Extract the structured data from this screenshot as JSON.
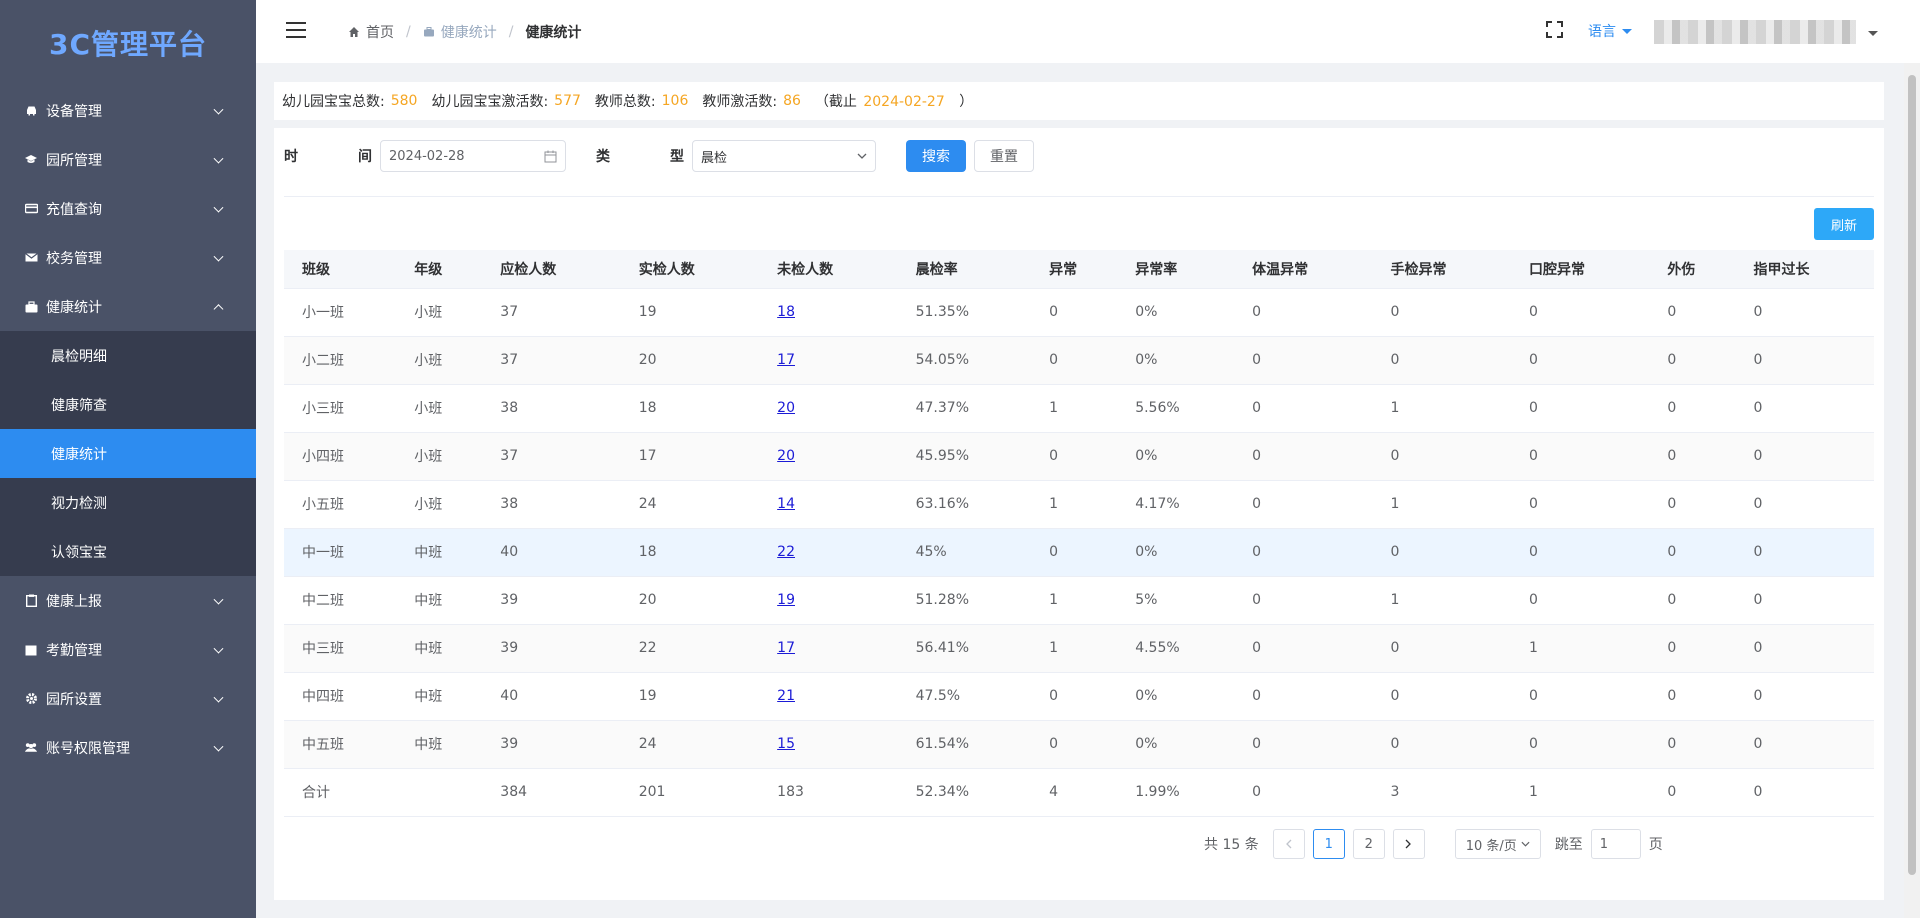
{
  "app": {
    "title": "3C管理平台"
  },
  "sidebar": {
    "items": [
      {
        "label": "设备管理",
        "icon": "car-icon",
        "expanded": false
      },
      {
        "label": "园所管理",
        "icon": "graduation-cap-icon",
        "expanded": false
      },
      {
        "label": "充值查询",
        "icon": "card-icon",
        "expanded": false
      },
      {
        "label": "校务管理",
        "icon": "envelope-icon",
        "expanded": false
      },
      {
        "label": "健康统计",
        "icon": "briefcase-icon",
        "expanded": true,
        "children": [
          {
            "label": "晨检明细"
          },
          {
            "label": "健康筛查"
          },
          {
            "label": "健康统计",
            "active": true
          },
          {
            "label": "视力检测"
          },
          {
            "label": "认领宝宝"
          }
        ]
      },
      {
        "label": "健康上报",
        "icon": "clipboard-icon",
        "expanded": false
      },
      {
        "label": "考勤管理",
        "icon": "calendar-icon",
        "expanded": false
      },
      {
        "label": "园所设置",
        "icon": "gear-icon",
        "expanded": false
      },
      {
        "label": "账号权限管理",
        "icon": "users-icon",
        "expanded": false
      }
    ]
  },
  "header": {
    "breadcrumb": [
      "首页",
      "健康统计",
      "健康统计"
    ],
    "language": "语言"
  },
  "summary": {
    "kid_total_label": "幼儿园宝宝总数:",
    "kid_total": "580",
    "kid_active_label": "幼儿园宝宝激活数:",
    "kid_active": "577",
    "teacher_total_label": "教师总数:",
    "teacher_total": "106",
    "teacher_active_label": "教师激活数:",
    "teacher_active": "86",
    "deadline_prefix": "（截止",
    "deadline_date": "2024-02-27",
    "deadline_suffix": "）"
  },
  "filters": {
    "time_label_a": "时",
    "time_label_b": "间",
    "date_value": "2024-02-28",
    "type_label_a": "类",
    "type_label_b": "型",
    "type_value": "晨检",
    "search_label": "搜索",
    "reset_label": "重置",
    "refresh_label": "刷新"
  },
  "table": {
    "columns": [
      "班级",
      "年级",
      "应检人数",
      "实检人数",
      "未检人数",
      "晨检率",
      "异常",
      "异常率",
      "体温异常",
      "手检异常",
      "口腔异常",
      "外伤",
      "指甲过长"
    ],
    "rows": [
      [
        "小一班",
        "小班",
        "37",
        "19",
        "18",
        "51.35%",
        "0",
        "0%",
        "0",
        "0",
        "0",
        "0",
        "0"
      ],
      [
        "小二班",
        "小班",
        "37",
        "20",
        "17",
        "54.05%",
        "0",
        "0%",
        "0",
        "0",
        "0",
        "0",
        "0"
      ],
      [
        "小三班",
        "小班",
        "38",
        "18",
        "20",
        "47.37%",
        "1",
        "5.56%",
        "0",
        "1",
        "0",
        "0",
        "0"
      ],
      [
        "小四班",
        "小班",
        "37",
        "17",
        "20",
        "45.95%",
        "0",
        "0%",
        "0",
        "0",
        "0",
        "0",
        "0"
      ],
      [
        "小五班",
        "小班",
        "38",
        "24",
        "14",
        "63.16%",
        "1",
        "4.17%",
        "0",
        "1",
        "0",
        "0",
        "0"
      ],
      [
        "中一班",
        "中班",
        "40",
        "18",
        "22",
        "45%",
        "0",
        "0%",
        "0",
        "0",
        "0",
        "0",
        "0"
      ],
      [
        "中二班",
        "中班",
        "39",
        "20",
        "19",
        "51.28%",
        "1",
        "5%",
        "0",
        "1",
        "0",
        "0",
        "0"
      ],
      [
        "中三班",
        "中班",
        "39",
        "22",
        "17",
        "56.41%",
        "1",
        "4.55%",
        "0",
        "0",
        "1",
        "0",
        "0"
      ],
      [
        "中四班",
        "中班",
        "40",
        "19",
        "21",
        "47.5%",
        "0",
        "0%",
        "0",
        "0",
        "0",
        "0",
        "0"
      ],
      [
        "中五班",
        "中班",
        "39",
        "24",
        "15",
        "61.54%",
        "0",
        "0%",
        "0",
        "0",
        "0",
        "0",
        "0"
      ]
    ],
    "total": [
      "合计",
      "",
      "384",
      "201",
      "183",
      "52.34%",
      "4",
      "1.99%",
      "0",
      "3",
      "1",
      "0",
      "0"
    ]
  },
  "pagination": {
    "total_text": "共 15 条",
    "pages": [
      "1",
      "2"
    ],
    "page_size": "10 条/页",
    "jump_label": "跳至",
    "jump_value": "1",
    "page_suffix": "页"
  }
}
